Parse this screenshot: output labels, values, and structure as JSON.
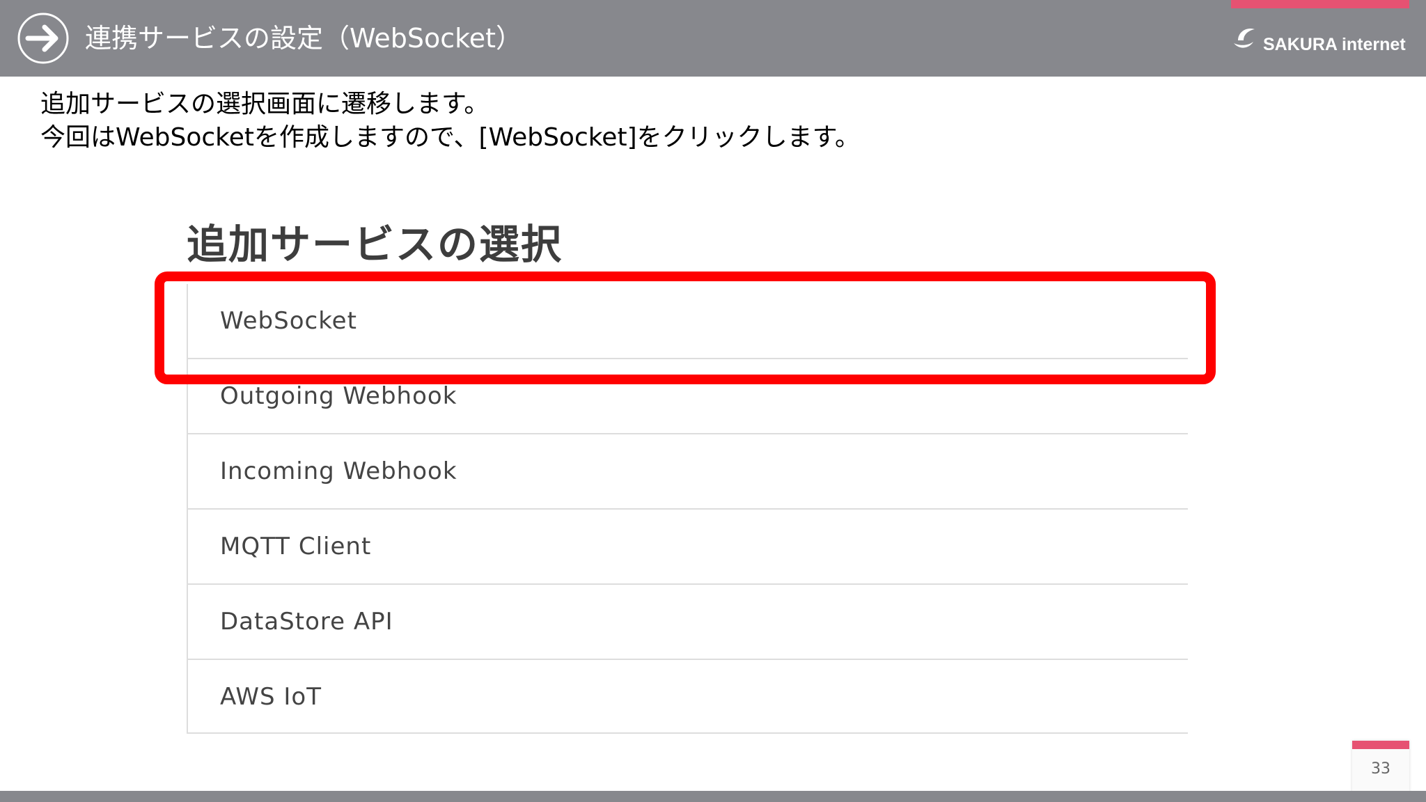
{
  "header": {
    "title": "連携サービスの設定（WebSocket）",
    "logo_text": "SAKURA internet",
    "accent_color": "#e65272",
    "background_color": "#87888d"
  },
  "instructions": {
    "line1": "追加サービスの選択画面に遷移します。",
    "line2": "今回はWebSocketを作成しますので、[WebSocket]をクリックします。"
  },
  "panel": {
    "title": "追加サービスの選択",
    "services": [
      {
        "label": "WebSocket"
      },
      {
        "label": "Outgoing Webhook"
      },
      {
        "label": "Incoming Webhook"
      },
      {
        "label": "MQTT Client"
      },
      {
        "label": "DataStore API"
      },
      {
        "label": "AWS IoT"
      }
    ]
  },
  "highlight_color": "#ff0000",
  "page_number": "33",
  "icons": {
    "header": "arrow-right-circle-icon",
    "logo": "sakura-logo-icon"
  }
}
